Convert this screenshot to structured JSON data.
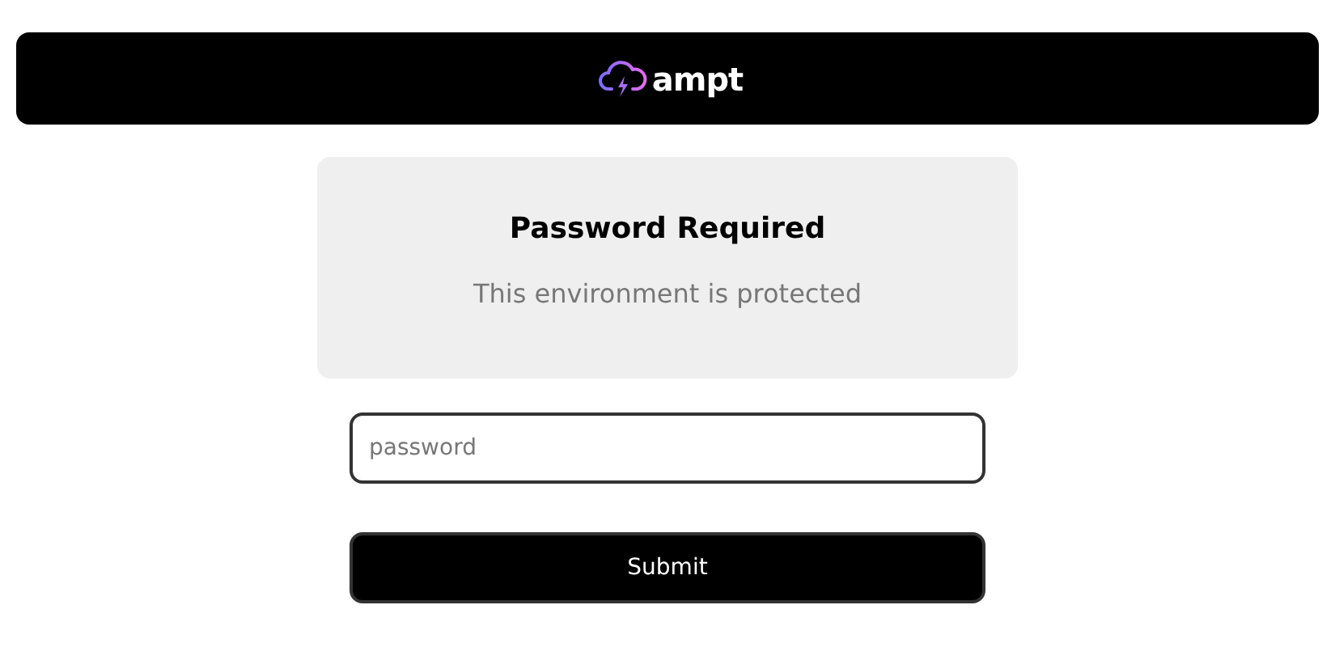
{
  "header": {
    "logo_text": "ampt"
  },
  "card": {
    "title": "Password Required",
    "subtitle": "This environment is protected"
  },
  "password_field": {
    "placeholder": "password"
  },
  "submit_button": {
    "label": "Submit"
  }
}
